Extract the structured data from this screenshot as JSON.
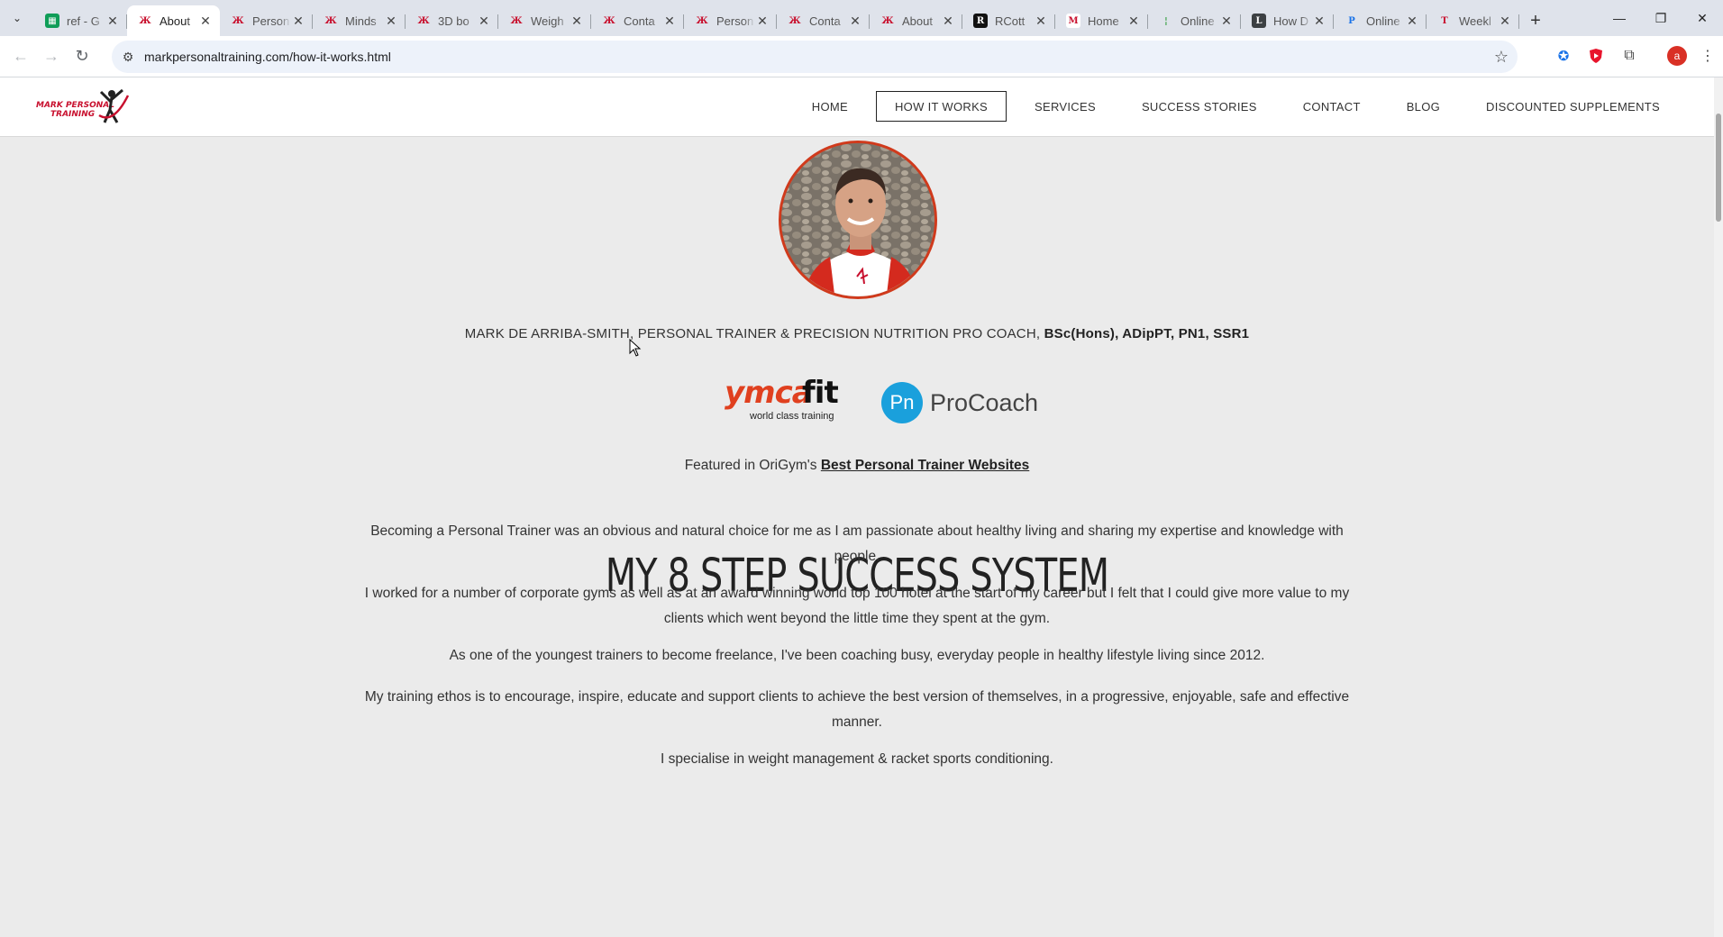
{
  "browser": {
    "tabs": [
      {
        "title": "ref - G",
        "favicon": "sheets-icon",
        "active": false
      },
      {
        "title": "About",
        "favicon": "mpt-icon",
        "active": true
      },
      {
        "title": "Person",
        "favicon": "mpt-icon",
        "active": false
      },
      {
        "title": "Minds",
        "favicon": "mpt-icon",
        "active": false
      },
      {
        "title": "3D bo",
        "favicon": "mpt-icon",
        "active": false
      },
      {
        "title": "Weigh",
        "favicon": "mpt-icon",
        "active": false
      },
      {
        "title": "Conta",
        "favicon": "mpt-icon",
        "active": false
      },
      {
        "title": "Person",
        "favicon": "mpt-icon",
        "active": false
      },
      {
        "title": "Conta",
        "favicon": "mpt-icon",
        "active": false
      },
      {
        "title": "About",
        "favicon": "mpt-icon",
        "active": false
      },
      {
        "title": "RCott",
        "favicon": "rc-icon",
        "active": false
      },
      {
        "title": "Home",
        "favicon": "home-site-icon",
        "active": false
      },
      {
        "title": "Online",
        "favicon": "online-icon",
        "active": false
      },
      {
        "title": "How D",
        "favicon": "howd-icon",
        "active": false
      },
      {
        "title": "Online",
        "favicon": "p-icon",
        "active": false
      },
      {
        "title": "Weekl",
        "favicon": "weekly-icon",
        "active": false
      }
    ],
    "url": "markpersonaltraining.com/how-it-works.html",
    "profile_initial": "a"
  },
  "site": {
    "logo_line1": "MARK PERSONAL",
    "logo_line2": "TRAINING",
    "nav": [
      "HOME",
      "HOW IT WORKS",
      "SERVICES",
      "SUCCESS STORIES",
      "CONTACT",
      "BLOG",
      "DISCOUNTED SUPPLEMENTS"
    ],
    "active_nav": "HOW IT WORKS"
  },
  "main": {
    "credits_plain": "MARK DE ARRIBA-SMITH, PERSONAL TRAINER & PRECISION NUTRITION PRO COACH, ",
    "credits_bold": "BSc(Hons), ADipPT, PN1, SSR1",
    "ymca_word": "YMCA",
    "ymca_fit": "fit",
    "ymca_tagline": "world class training",
    "pn_badge": "Pn",
    "pn_text": "ProCoach",
    "featured_prefix": "Featured in OriGym's ",
    "featured_link": "Best Personal Trainer Websites",
    "heading": "MY 8 STEP SUCCESS SYSTEM",
    "paragraphs": [
      "Becoming a Personal Trainer was an obvious and natural choice for me as I am passionate about healthy living and sharing my expertise and knowledge with people.",
      "I worked for a number of corporate gyms as well as at an award winning world top 100 hotel at the start of my career but I felt that I could give more value to my clients which went beyond the little time they spent at the gym.",
      "As one of the youngest trainers to become freelance, I've been coaching busy, everyday people in healthy lifestyle living since 2012.",
      "My training ethos is to encourage, inspire, educate and support clients to achieve the best version of themselves, in a progressive, enjoyable, safe and effective manner.",
      "I specialise in weight management & racket sports conditioning."
    ]
  },
  "colors": {
    "brand_red": "#c8102e",
    "ymca_orange": "#e0401f",
    "procoach_blue": "#1aa0dc",
    "page_bg": "#ebebeb"
  }
}
